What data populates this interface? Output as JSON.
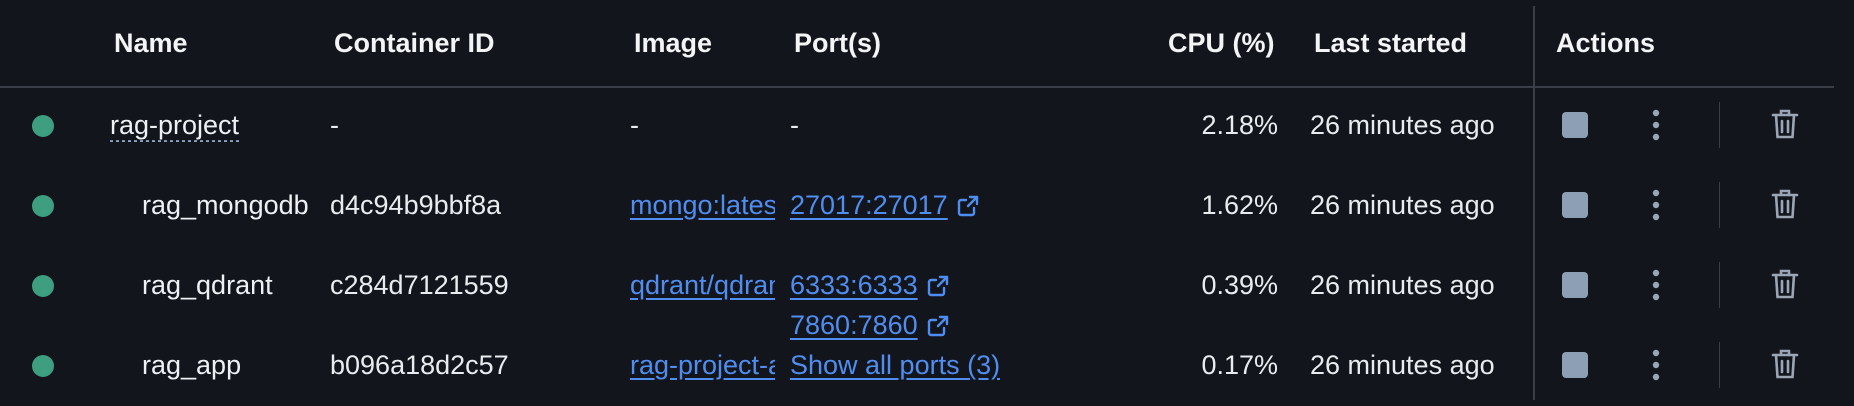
{
  "columns": {
    "name": "Name",
    "container_id": "Container ID",
    "image": "Image",
    "ports": "Port(s)",
    "cpu": "CPU (%)",
    "last_started": "Last started",
    "actions": "Actions"
  },
  "rows": [
    {
      "name": "rag-project",
      "container_id": "-",
      "image": "-",
      "port": "-",
      "cpu": "2.18%",
      "last_started": "26 minutes ago",
      "status_color": "#3e9e80"
    },
    {
      "name": "rag_mongodb",
      "container_id": "d4c94b9bbf8a",
      "image": "mongo:latest",
      "port": "27017:27017",
      "cpu": "1.62%",
      "last_started": "26 minutes ago",
      "status_color": "#3e9e80"
    },
    {
      "name": "rag_qdrant",
      "container_id": "c284d7121559",
      "image": "qdrant/qdrant",
      "port": "6333:6333",
      "cpu": "0.39%",
      "last_started": "26 minutes ago",
      "status_color": "#3e9e80"
    },
    {
      "name": "rag_app",
      "container_id": "b096a18d2c57",
      "image": "rag-project-app",
      "port": "7860:7860",
      "more_ports": "Show all ports (3)",
      "cpu": "0.17%",
      "last_started": "26 minutes ago",
      "status_color": "#3e9e80"
    }
  ],
  "icons": {
    "stop": "stop-square-icon",
    "more": "kebab-menu-icon",
    "delete": "trash-icon",
    "external": "external-link-icon"
  },
  "colors": {
    "background": "#12151b",
    "link": "#4f8ef0",
    "running": "#3e9e80",
    "divider": "#3a3f47"
  }
}
